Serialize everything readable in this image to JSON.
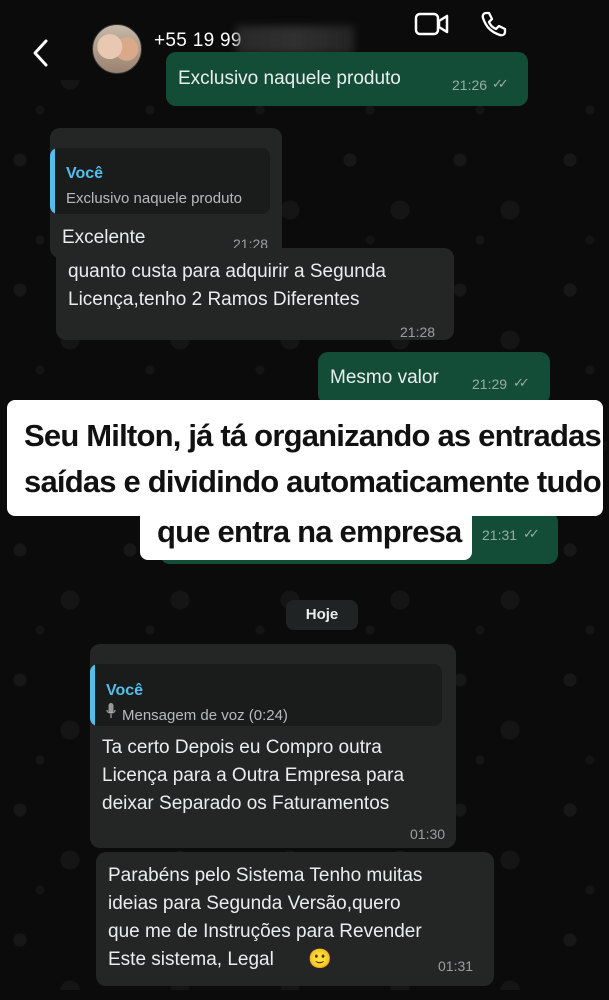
{
  "header": {
    "contact_name": "+55 19 99",
    "back_icon": "chevron-left-icon",
    "video_icon": "video-camera-icon",
    "call_icon": "phone-icon"
  },
  "messages": [
    {
      "text": "Exclusivo naquele produto",
      "time": "21:26",
      "status": "read"
    },
    {
      "quote_author": "Você",
      "quote_text": "Exclusivo naquele produto",
      "text": "Excelente",
      "time": "21:28"
    },
    {
      "text_line1": "quanto custa para adquirir a Segunda",
      "text_line2": "Licença,tenho 2 Ramos Diferentes",
      "time": "21:28"
    },
    {
      "text": "Mesmo valor",
      "time": "21:29",
      "status": "read"
    },
    {
      "time": "21:31",
      "status": "read"
    }
  ],
  "overlay": {
    "line1": "Seu Milton, já tá organizando as entradas,",
    "line2": "saídas e dividindo automaticamente tudo o",
    "line3": "que entra na empresa"
  },
  "date_separator": "Hoje",
  "later_messages": [
    {
      "quote_author": "Você",
      "quote_icon": "microphone-icon",
      "quote_text": "Mensagem de voz (0:24)",
      "text_line1": "Ta certo Depois eu Compro outra",
      "text_line2": "Licença para a Outra Empresa para",
      "text_line3": "deixar Separado os Faturamentos",
      "time": "01:30"
    },
    {
      "text_line1": "Parabéns pelo Sistema Tenho muitas",
      "text_line2": "ideias para Segunda Versão,quero",
      "text_line3": "que me de Instruções para Revender",
      "text_line4": "Este sistema, Legal",
      "emoji": "🙂",
      "time": "01:31"
    }
  ],
  "colors": {
    "outgoing_bubble": "#144d37",
    "incoming_bubble": "#242626",
    "quote_accent": "#53bdeb",
    "background": "#0b0b0b"
  }
}
